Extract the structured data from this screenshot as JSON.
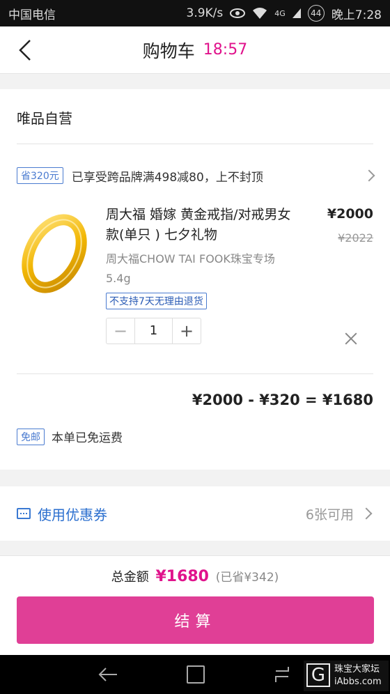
{
  "status_bar": {
    "carrier": "中国电信",
    "speed": "3.9K/s",
    "network": "4G",
    "battery": "44",
    "time": "晚上7:28"
  },
  "header": {
    "title": "购物车",
    "timer": "18:57"
  },
  "store": {
    "name": "唯品自营",
    "promo_tag": "省320元",
    "promo_text": "已享受跨品牌满498减80，上不封顶"
  },
  "product": {
    "name": "周大福 婚嫁 黄金戒指/对戒男女款(单只 ) 七夕礼物",
    "price": "¥2000",
    "original_price": "¥2022",
    "shop": "周大福CHOW TAI FOOK珠宝专场",
    "weight": "5.4g",
    "return_policy": "不支持7天无理由退货",
    "quantity": "1",
    "minus_symbol": "−",
    "plus_symbol": "+"
  },
  "summary": {
    "calculation": "¥2000 - ¥320 = ¥1680",
    "shipping_tag": "免邮",
    "shipping_text": "本单已免运费"
  },
  "coupon": {
    "label": "使用优惠券",
    "available": "6张可用"
  },
  "bottom": {
    "total_label": "总金额",
    "total_amount": "¥1680",
    "saved": "(已省¥342)",
    "checkout_label": "结算"
  },
  "watermark": {
    "letter": "G",
    "line1": "珠宝大家坛",
    "line2": "iAbbs.com"
  },
  "colors": {
    "accent": "#e0138c",
    "checkout_bg": "#e03f96",
    "link_blue": "#2b6fcf",
    "ring_gold": "#f2b705"
  },
  "icons": {
    "back": "chevron-left-icon",
    "remove": "close-icon",
    "coupon": "ticket-icon"
  }
}
